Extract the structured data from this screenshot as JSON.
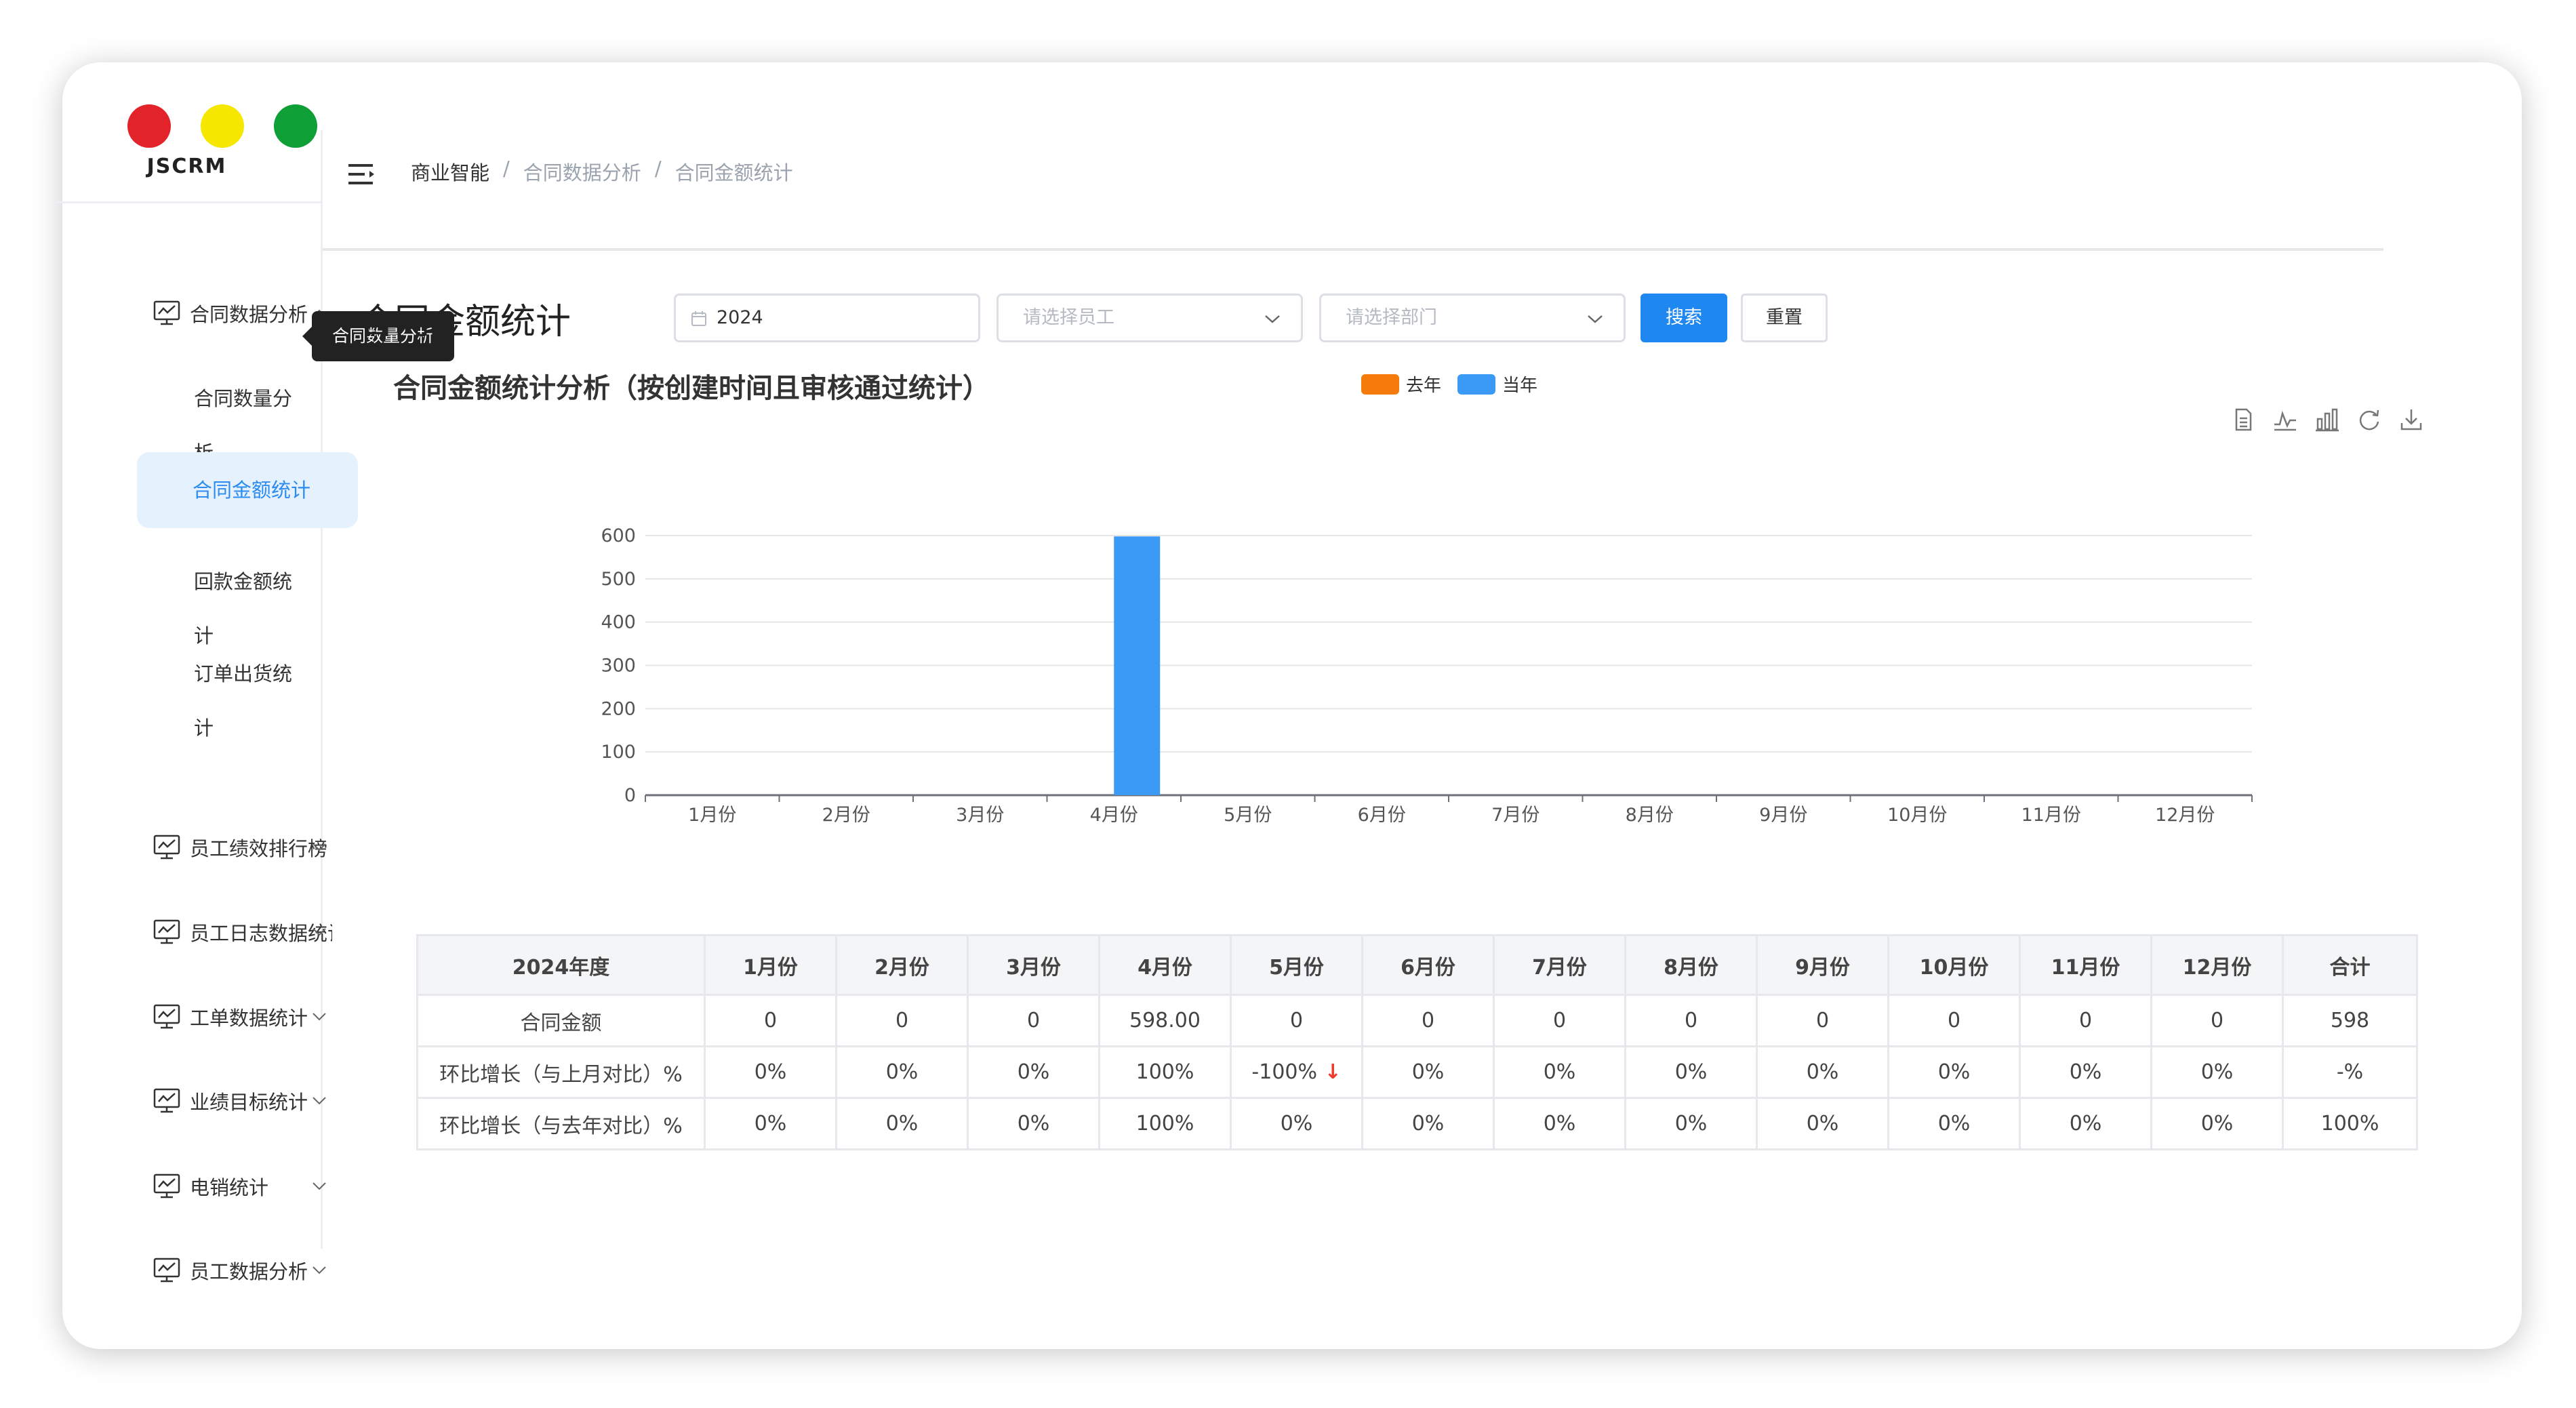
{
  "app": {
    "logo": "JSCRM"
  },
  "sidebar": {
    "groups": [
      {
        "label": "合同数据分析",
        "expanded": true
      },
      {
        "label": "员工绩效排行榜"
      },
      {
        "label": "员工日志数据统计"
      },
      {
        "label": "工单数据统计"
      },
      {
        "label": "业绩目标统计"
      },
      {
        "label": "电销统计"
      },
      {
        "label": "员工数据分析"
      }
    ],
    "submenu": [
      {
        "label": "合同数量分析"
      },
      {
        "label": "合同金额统计",
        "active": true
      },
      {
        "label": "回款金额统计"
      },
      {
        "label": "订单出货统计"
      }
    ],
    "tooltip": "合同数量分析"
  },
  "header": {
    "breadcrumb": [
      "商业智能",
      "合同数据分析",
      "合同金额统计"
    ],
    "separator": "/"
  },
  "page": {
    "title": "合同金额统计",
    "filters": {
      "year": "2024",
      "employee_placeholder": "请选择员工",
      "department_placeholder": "请选择部门",
      "search_label": "搜索",
      "reset_label": "重置"
    }
  },
  "chart_title": "合同金额统计分析（按创建时间且审核通过统计）",
  "chart_data": {
    "type": "bar",
    "title": "合同金额统计分析（按创建时间且审核通过统计）",
    "categories": [
      "1月份",
      "2月份",
      "3月份",
      "4月份",
      "5月份",
      "6月份",
      "7月份",
      "8月份",
      "9月份",
      "10月份",
      "11月份",
      "12月份"
    ],
    "series": [
      {
        "name": "去年",
        "color": "#f57c0a",
        "values": [
          0,
          0,
          0,
          0,
          0,
          0,
          0,
          0,
          0,
          0,
          0,
          0
        ]
      },
      {
        "name": "当年",
        "color": "#3a9af5",
        "values": [
          0,
          0,
          0,
          598,
          0,
          0,
          0,
          0,
          0,
          0,
          0,
          0
        ]
      }
    ],
    "yticks": [
      "0",
      "100",
      "200",
      "300",
      "400",
      "500",
      "600"
    ],
    "ylim": [
      0,
      600
    ],
    "grid": true,
    "legend": "top-center"
  },
  "toolbox": [
    "data-view-icon",
    "line-chart-icon",
    "bar-chart-icon",
    "refresh-icon",
    "download-icon"
  ],
  "table": {
    "headers": [
      "2024年度",
      "1月份",
      "2月份",
      "3月份",
      "4月份",
      "5月份",
      "6月份",
      "7月份",
      "8月份",
      "9月份",
      "10月份",
      "11月份",
      "12月份",
      "合计"
    ],
    "rows": [
      [
        "合同金额",
        "0",
        "0",
        "0",
        "598.00",
        "0",
        "0",
        "0",
        "0",
        "0",
        "0",
        "0",
        "0",
        "598"
      ],
      [
        "环比增长（与上月对比）%",
        "0%",
        "0%",
        "0%",
        "100%",
        "-100%",
        "0%",
        "0%",
        "0%",
        "0%",
        "0%",
        "0%",
        "0%",
        "-%"
      ],
      [
        "环比增长（与去年对比）%",
        "0%",
        "0%",
        "0%",
        "100%",
        "0%",
        "0%",
        "0%",
        "0%",
        "0%",
        "0%",
        "0%",
        "0%",
        "100%"
      ]
    ]
  }
}
